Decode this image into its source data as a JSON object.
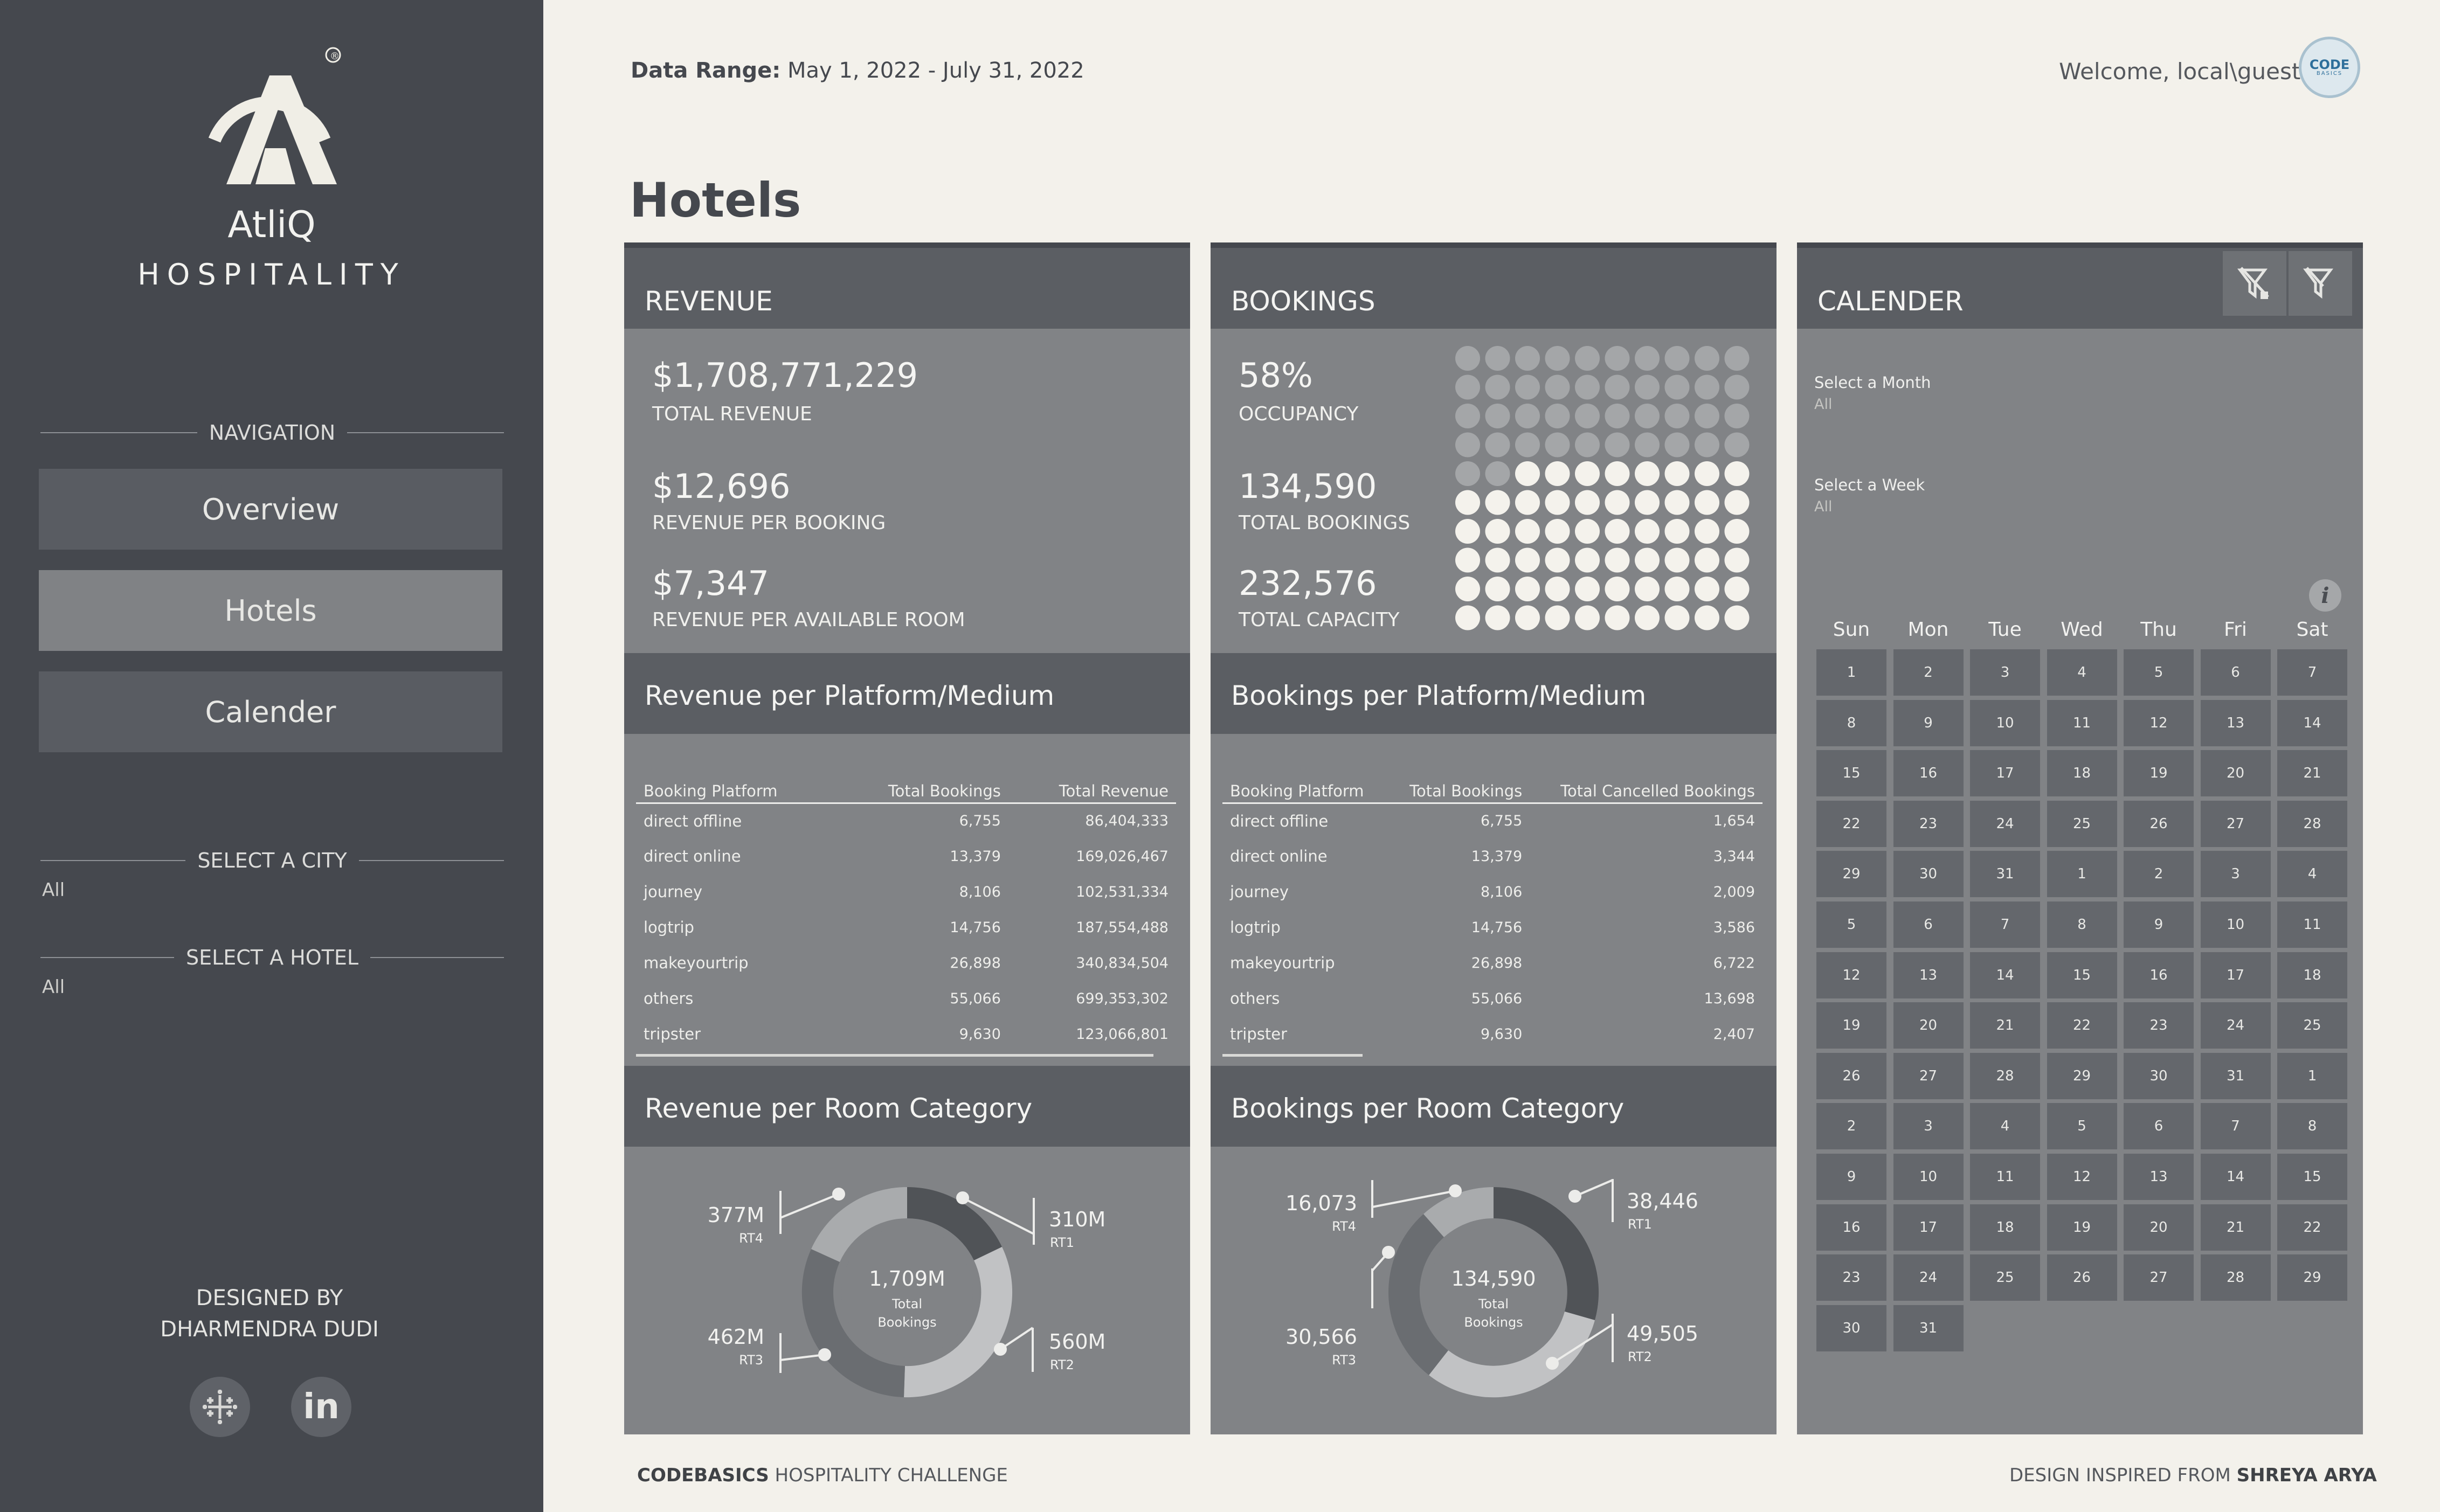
{
  "brand": {
    "name": "AtliQ",
    "subtitle": "HOSPITALITY",
    "registered": "®"
  },
  "sidebar": {
    "navigation_label": "NAVIGATION",
    "nav": [
      {
        "label": "Overview",
        "active": false
      },
      {
        "label": "Hotels",
        "active": true
      },
      {
        "label": "Calender",
        "active": false
      }
    ],
    "city_filter": {
      "label": "SELECT A CITY",
      "value": "All"
    },
    "hotel_filter": {
      "label": "SELECT A HOTEL",
      "value": "All"
    },
    "designed_by": {
      "line1": "DESIGNED BY",
      "line2": "DHARMENDRA DUDI"
    },
    "social": {
      "tableau_icon": "tableau-icon",
      "linkedin_label": "in"
    }
  },
  "header": {
    "date_range_label": "Data Range:",
    "date_range_value": "May 1, 2022 - July 31, 2022",
    "welcome": "Welcome, local\\guest",
    "avatar_text": "CODE",
    "avatar_sub": "BASICS",
    "page_title": "Hotels"
  },
  "revenue": {
    "title": "REVENUE",
    "kpis": [
      {
        "value": "$1,708,771,229",
        "label": "TOTAL REVENUE"
      },
      {
        "value": "$12,696",
        "label": "REVENUE PER BOOKING"
      },
      {
        "value": "$7,347",
        "label": "REVENUE PER AVAILABLE ROOM"
      }
    ],
    "platform_title": "Revenue per Platform/Medium",
    "platform_columns": [
      "Booking Platform",
      "Total Bookings",
      "Total Revenue"
    ],
    "platform_rows": [
      [
        "direct offline",
        "6,755",
        "86,404,333"
      ],
      [
        "direct online",
        "13,379",
        "169,026,467"
      ],
      [
        "journey",
        "8,106",
        "102,531,334"
      ],
      [
        "logtrip",
        "14,756",
        "187,554,488"
      ],
      [
        "makeyourtrip",
        "26,898",
        "340,834,504"
      ],
      [
        "others",
        "55,066",
        "699,353,302"
      ],
      [
        "tripster",
        "9,630",
        "123,066,801"
      ]
    ],
    "room_title": "Revenue per Room Category",
    "donut_center": {
      "value": "1,709M",
      "line1": "Total",
      "line2": "Bookings"
    },
    "donut_labels": {
      "rt4": {
        "value": "377M",
        "code": "RT4"
      },
      "rt1": {
        "value": "310M",
        "code": "RT1"
      },
      "rt3": {
        "value": "462M",
        "code": "RT3"
      },
      "rt2": {
        "value": "560M",
        "code": "RT2"
      }
    }
  },
  "bookings": {
    "title": "BOOKINGS",
    "kpis": [
      {
        "value": "58%",
        "label": "OCCUPANCY"
      },
      {
        "value": "134,590",
        "label": "TOTAL BOOKINGS"
      },
      {
        "value": "232,576",
        "label": "TOTAL CAPACITY"
      }
    ],
    "occupancy_pct": 58,
    "platform_title": "Bookings per Platform/Medium",
    "platform_columns": [
      "Booking Platform",
      "Total Bookings",
      "Total Cancelled Bookings"
    ],
    "platform_rows": [
      [
        "direct offline",
        "6,755",
        "1,654"
      ],
      [
        "direct online",
        "13,379",
        "3,344"
      ],
      [
        "journey",
        "8,106",
        "2,009"
      ],
      [
        "logtrip",
        "14,756",
        "3,586"
      ],
      [
        "makeyourtrip",
        "26,898",
        "6,722"
      ],
      [
        "others",
        "55,066",
        "13,698"
      ],
      [
        "tripster",
        "9,630",
        "2,407"
      ]
    ],
    "room_title": "Bookings per Room Category",
    "donut_center": {
      "value": "134,590",
      "line1": "Total",
      "line2": "Bookings"
    },
    "donut_labels": {
      "rt4": {
        "value": "16,073",
        "code": "RT4"
      },
      "rt1": {
        "value": "38,446",
        "code": "RT1"
      },
      "rt3": {
        "value": "30,566",
        "code": "RT3"
      },
      "rt2": {
        "value": "49,505",
        "code": "RT2"
      }
    }
  },
  "calendar": {
    "title": "CALENDER",
    "month_filter": {
      "label": "Select a Month",
      "value": "All"
    },
    "week_filter": {
      "label": "Select a Week",
      "value": "All"
    },
    "weekdays": [
      "Sun",
      "Mon",
      "Tue",
      "Wed",
      "Thu",
      "Fri",
      "Sat"
    ],
    "days": [
      "1",
      "2",
      "3",
      "4",
      "5",
      "6",
      "7",
      "8",
      "9",
      "10",
      "11",
      "12",
      "13",
      "14",
      "15",
      "16",
      "17",
      "18",
      "19",
      "20",
      "21",
      "22",
      "23",
      "24",
      "25",
      "26",
      "27",
      "28",
      "29",
      "30",
      "31",
      "1",
      "2",
      "3",
      "4",
      "5",
      "6",
      "7",
      "8",
      "9",
      "10",
      "11",
      "12",
      "13",
      "14",
      "15",
      "16",
      "17",
      "18",
      "19",
      "20",
      "21",
      "22",
      "23",
      "24",
      "25",
      "26",
      "27",
      "28",
      "29",
      "30",
      "31",
      "1",
      "2",
      "3",
      "4",
      "5",
      "6",
      "7",
      "8",
      "9",
      "10",
      "11",
      "12",
      "13",
      "14",
      "15",
      "16",
      "17",
      "18",
      "19",
      "20",
      "21",
      "22",
      "23",
      "24",
      "25",
      "26",
      "27",
      "28",
      "29",
      "30",
      "31"
    ],
    "info_icon": "i"
  },
  "footer": {
    "left_bold": "CODEBASICS",
    "left_rest": " HOSPITALITY CHALLENGE",
    "right_rest": "DESIGN INSPIRED FROM ",
    "right_bold": "SHREYA ARYA"
  },
  "colors": {
    "sidebar": "#45484e",
    "panel": "#818386",
    "panel_header": "#5b5e63",
    "background": "#f3f1eb",
    "dot_filled": "#f4f2ec",
    "dot_empty": "#a4a6a8"
  }
}
